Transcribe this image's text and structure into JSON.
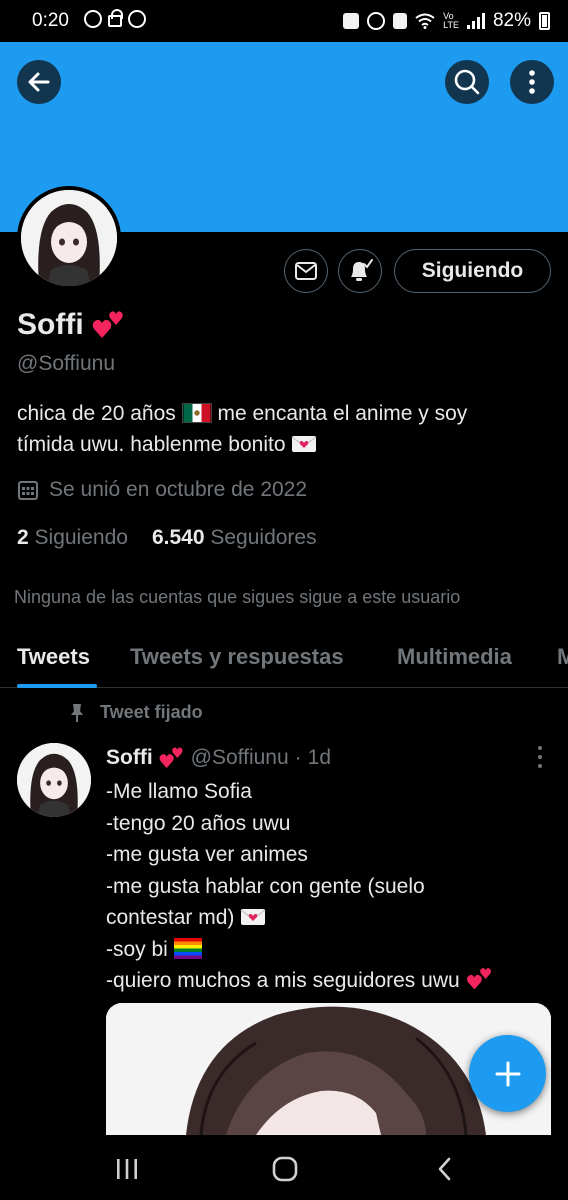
{
  "status_bar": {
    "time": "0:20",
    "battery": "82%"
  },
  "header": {
    "back_icon": "arrow-left-icon",
    "search_icon": "search-icon",
    "more_icon": "more-vertical-icon",
    "banner_color": "#1d9bf0"
  },
  "profile": {
    "display_name": "Soffi",
    "handle": "@Soffiunu",
    "bio_line1": "chica de 20 años",
    "bio_line1b": "me encanta el anime y soy",
    "bio_line2": "tímida uwu. hablenme bonito",
    "joined": "Se unió en octubre de 2022",
    "following_count": "2",
    "following_label": "Siguiendo",
    "followers_count": "6.540",
    "followers_label": "Seguidores",
    "mutuals_text": "Ninguna de las cuentas que sigues sigue a este usuario",
    "follow_button_label": "Siguiendo"
  },
  "tabs": [
    {
      "label": "Tweets",
      "active": true
    },
    {
      "label": "Tweets y respuestas",
      "active": false
    },
    {
      "label": "Multimedia",
      "active": false
    },
    {
      "label": "M",
      "active": false
    }
  ],
  "pinned_tweet": {
    "pinned_label": "Tweet fijado",
    "name": "Soffi",
    "handle": "@Soffiunu",
    "separator": "·",
    "time": "1d",
    "lines": [
      "-Me llamo Sofia",
      "-tengo 20 años uwu",
      "-me gusta ver animes",
      "-me gusta hablar con gente (suelo",
      "contestar md)",
      "-soy bi",
      "-quiero muchos a mis seguidores uwu"
    ]
  },
  "colors": {
    "accent": "#1d9bf0",
    "background": "#000000",
    "text_primary": "#e7e9ea",
    "text_secondary": "#71767b",
    "heart": "#f4245e"
  }
}
